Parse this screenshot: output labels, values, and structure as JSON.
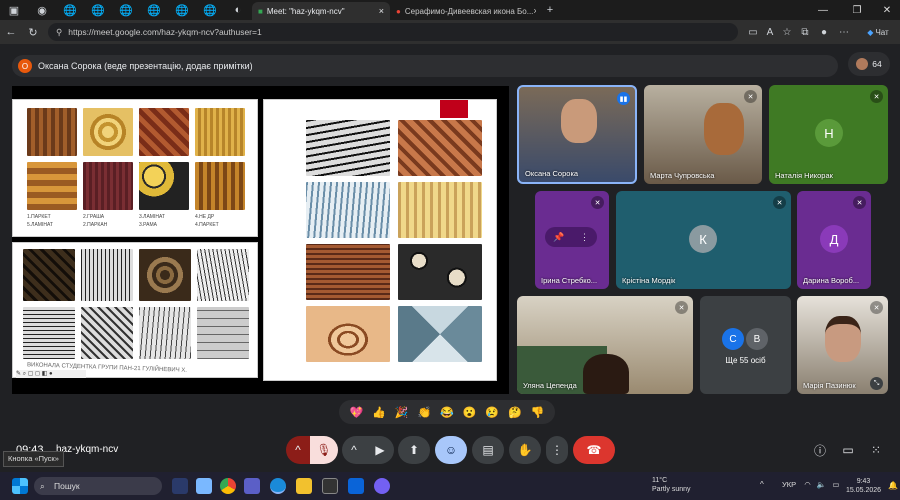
{
  "browser": {
    "tabs": [
      {
        "title": "Meet: \"haz-ykqm-ncv\"",
        "active": true
      },
      {
        "title": "Серафимо-Дивеевская икона Бо...",
        "active": false
      }
    ],
    "url": "https://meet.google.com/haz-ykqm-ncv?authuser=1",
    "chat_label": "Чат",
    "new_tab": "+"
  },
  "meet": {
    "presenter_initial": "О",
    "presenter_text": "Оксана Сорока (веде презентацію, додає примітки)",
    "people_count": "64",
    "participants": [
      {
        "name": "Оксана Сорока",
        "type": "video",
        "initial": ""
      },
      {
        "name": "Марта Чупровська",
        "type": "video",
        "initial": ""
      },
      {
        "name": "Наталія Никорак",
        "type": "avatar",
        "initial": "Н",
        "color": "#4f8a2f"
      },
      {
        "name": "Ірина Стребко...",
        "type": "avatar",
        "initial": "",
        "color": "#6a2c91"
      },
      {
        "name": "Крістіна Мордік",
        "type": "avatar",
        "initial": "К",
        "color": "#1f5e6e"
      },
      {
        "name": "Дарина Вороб...",
        "type": "avatar",
        "initial": "Д",
        "color": "#6a2c91"
      },
      {
        "name": "Уляна Цепенда",
        "type": "video",
        "initial": ""
      },
      {
        "name": "Ще 55 осіб",
        "type": "more",
        "initial": ""
      },
      {
        "name": "Марія Пазинюк",
        "type": "video",
        "initial": ""
      }
    ],
    "more_avatars": [
      "С",
      "В"
    ],
    "reactions": [
      "💖",
      "👍",
      "🎉",
      "👏",
      "😂",
      "😮",
      "😢",
      "🤔",
      "👎"
    ],
    "time": "09:43",
    "meeting_id": "haz-ykqm-ncv",
    "tooltip": "Кнопка «Пуск»",
    "slide_labels_left": [
      "1.ПАРКЕТ",
      "2.ГРАША",
      "3.ЛАМІНАТ",
      "4.НЕ ДР",
      "5.ЛАМІНАТ",
      "2.ПАРКАН",
      "3.РАМА",
      "4.ПАРКЕТ"
    ],
    "slide_footer": "ВИКОНАЛА СТУДЕНТКА ГРУПИ ПАН-21 ГУЛІЙНЕВИЧ Х."
  },
  "taskbar": {
    "search_placeholder": "Пошук",
    "weather_temp": "11°C",
    "weather_desc": "Partly sunny",
    "lang": "УКР",
    "clock_time": "9:43",
    "clock_date": "15.05.2026"
  }
}
